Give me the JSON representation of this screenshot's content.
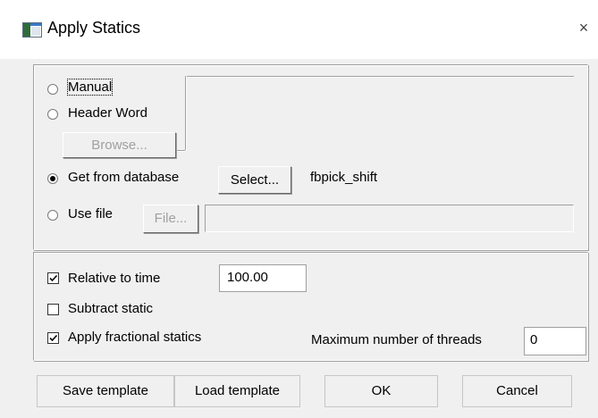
{
  "window": {
    "title": "Apply Statics",
    "close_glyph": "×",
    "icon": "app-window-icon"
  },
  "source": {
    "manual_label": "Manual",
    "header_word_label": "Header Word",
    "browse_label": "Browse...",
    "database_label": "Get from database",
    "select_label": "Select...",
    "database_value": "fbpick_shift",
    "use_file_label": "Use file",
    "file_label": "File...",
    "file_value": "",
    "header_word_value": "",
    "selected": "Get from database"
  },
  "options": {
    "relative_time_label": "Relative to time",
    "relative_time_checked": true,
    "relative_time_value": "100.00",
    "subtract_label": "Subtract static",
    "subtract_checked": false,
    "fractional_label": "Apply fractional statics",
    "fractional_checked": true,
    "threads_label": "Maximum number of threads",
    "threads_value": "0"
  },
  "footer": {
    "save_label": "Save template",
    "load_label": "Load template",
    "ok_label": "OK",
    "cancel_label": "Cancel"
  }
}
